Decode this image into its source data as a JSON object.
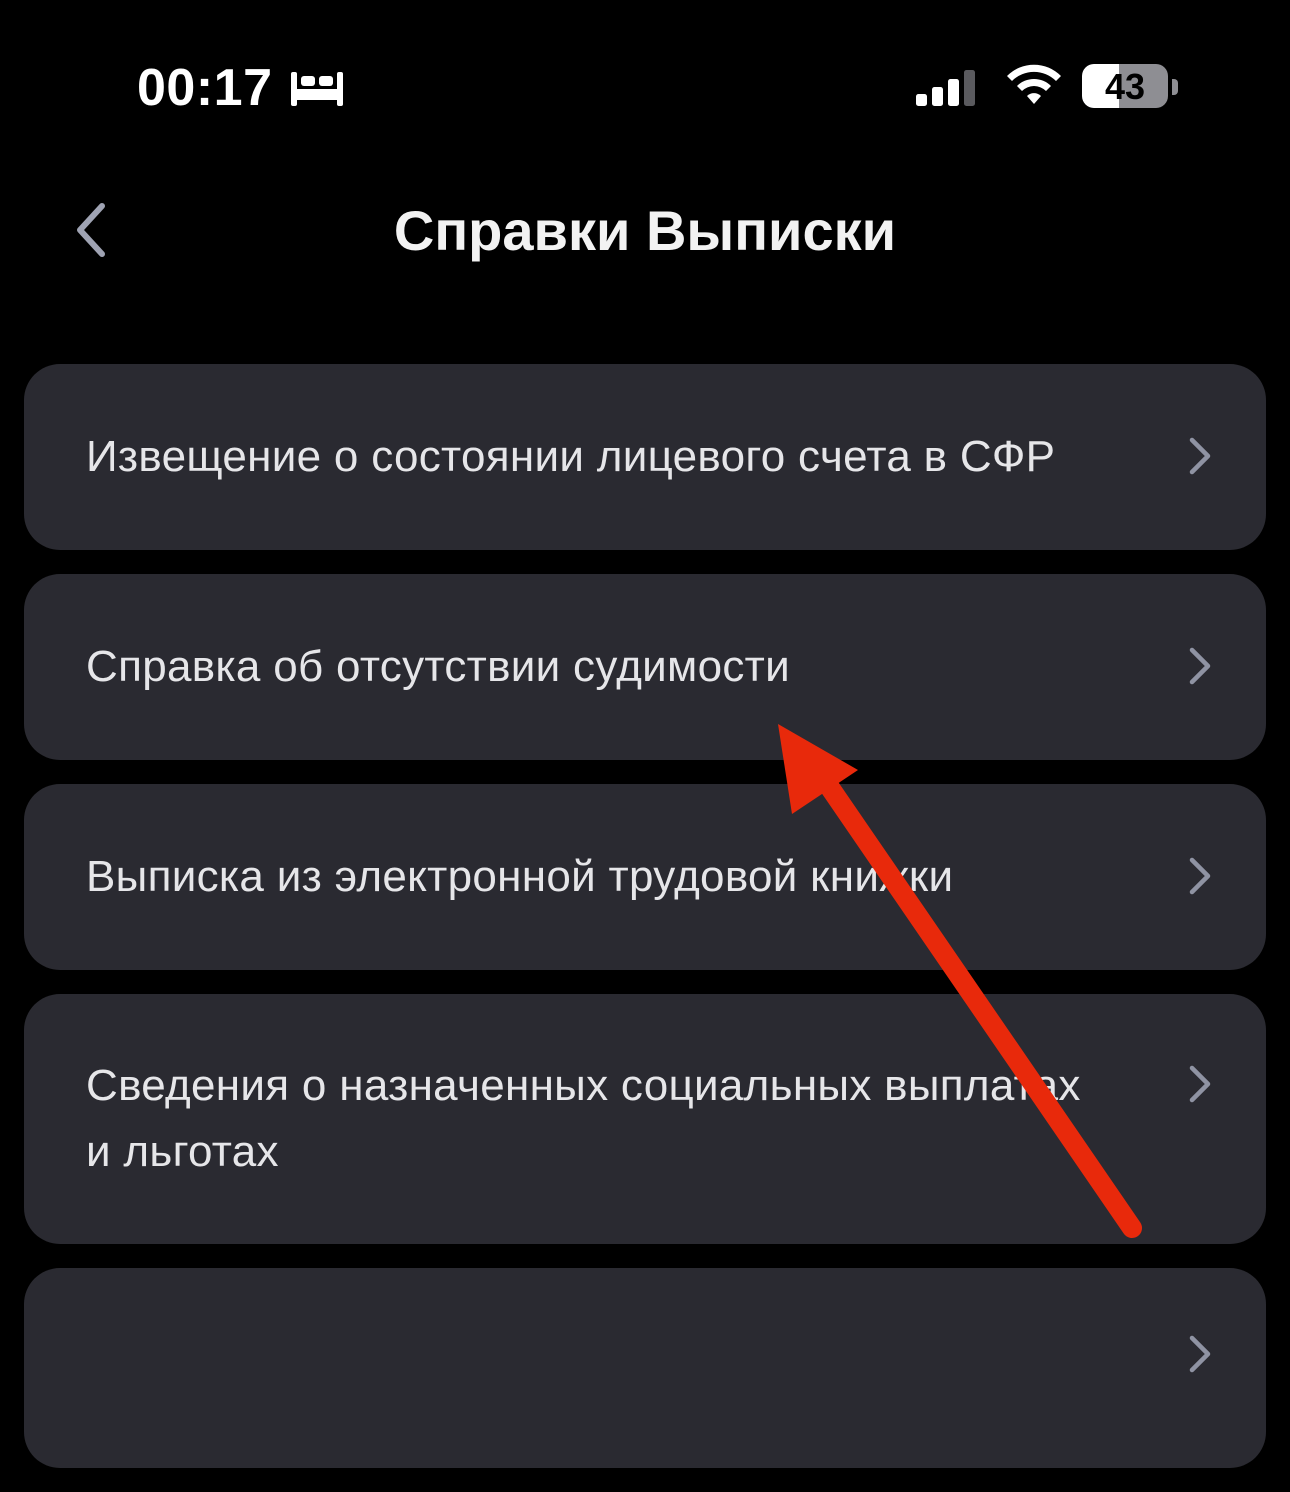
{
  "status_bar": {
    "time": "00:17",
    "sleep_icon": "bed-icon",
    "signal_icon": "cellular-signal-icon",
    "wifi_icon": "wifi-icon",
    "battery_level": "43",
    "battery_fraction": 0.43
  },
  "header": {
    "back_icon": "chevron-left-icon",
    "title": "Справки Выписки"
  },
  "items": [
    {
      "label": "Извещение о состоянии лицевого счета в СФР",
      "chevron_icon": "chevron-right-icon"
    },
    {
      "label": "Справка об отсутствии судимости",
      "chevron_icon": "chevron-right-icon"
    },
    {
      "label": "Выписка из электронной трудовой книжки",
      "chevron_icon": "chevron-right-icon"
    },
    {
      "label": "Сведения о назначенных социальных выплатах и льготах",
      "chevron_icon": "chevron-right-icon"
    },
    {
      "label": "",
      "chevron_icon": "chevron-right-icon"
    }
  ],
  "annotation": {
    "icon": "red-arrow-icon",
    "color": "#e8290b"
  },
  "colors": {
    "background": "#000000",
    "card": "#2a2a31",
    "text": "#e6e6e9",
    "chevron": "#8f93a3"
  }
}
